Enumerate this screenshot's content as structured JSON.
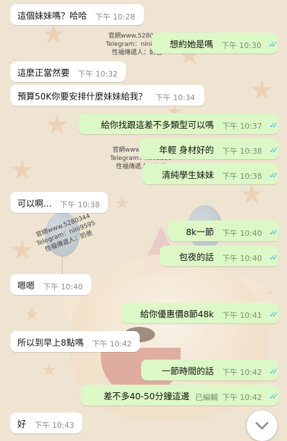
{
  "watermark": {
    "line1": "官網www.5280344",
    "line2": "Telegram：nini9595",
    "line3": "性福傳遞人：奶爸"
  },
  "messages": [
    {
      "dir": "in",
      "text": "這個妹妹嗎？哈哈",
      "time": "下午 10:28"
    },
    {
      "dir": "out",
      "text": "想約她是嗎",
      "time": "下午 10:30"
    },
    {
      "dir": "in",
      "text": "這麼正當然要",
      "time": "下午 10:32"
    },
    {
      "dir": "in",
      "text": "預算50K你要安排什麼妹妹給我？",
      "time": "下午 10:34"
    },
    {
      "dir": "out",
      "text": "給你找跟這差不多類型可以嗎",
      "time": "下午 10:37"
    },
    {
      "dir": "out",
      "text": "年輕  身材好的",
      "time": "下午 10:38"
    },
    {
      "dir": "out",
      "text": "清純學生妹妹",
      "time": "下午 10:38"
    },
    {
      "dir": "in",
      "text": "可以啊...",
      "time": "下午 10:38"
    },
    {
      "dir": "out",
      "text": "8k一節",
      "time": "下午 10:40"
    },
    {
      "dir": "out",
      "text": "包夜的話",
      "time": "下午 10:40"
    },
    {
      "dir": "in",
      "text": "嗯嗯",
      "time": "下午 10:40"
    },
    {
      "dir": "out",
      "text": "給你優惠價8節48k",
      "time": "下午 10:41"
    },
    {
      "dir": "in",
      "text": "所以到早上8點嗎",
      "time": "下午 10:42"
    },
    {
      "dir": "out",
      "text": "一節時間的話",
      "time": "下午 10:42"
    },
    {
      "dir": "out",
      "text": "差不多40-50分鐘這邊",
      "time": "下午 10:42",
      "edited": "已編輯"
    },
    {
      "dir": "in",
      "text": "好",
      "time": "下午 10:43"
    }
  ],
  "colors": {
    "incoming": "#ffffff",
    "outgoing": "#dcf8c6",
    "read_ticks": "#53bdeb",
    "background": "#efe3d2"
  },
  "icons": {
    "read_receipt": "double-check-icon",
    "scroll_down": "chevron-down-icon"
  }
}
